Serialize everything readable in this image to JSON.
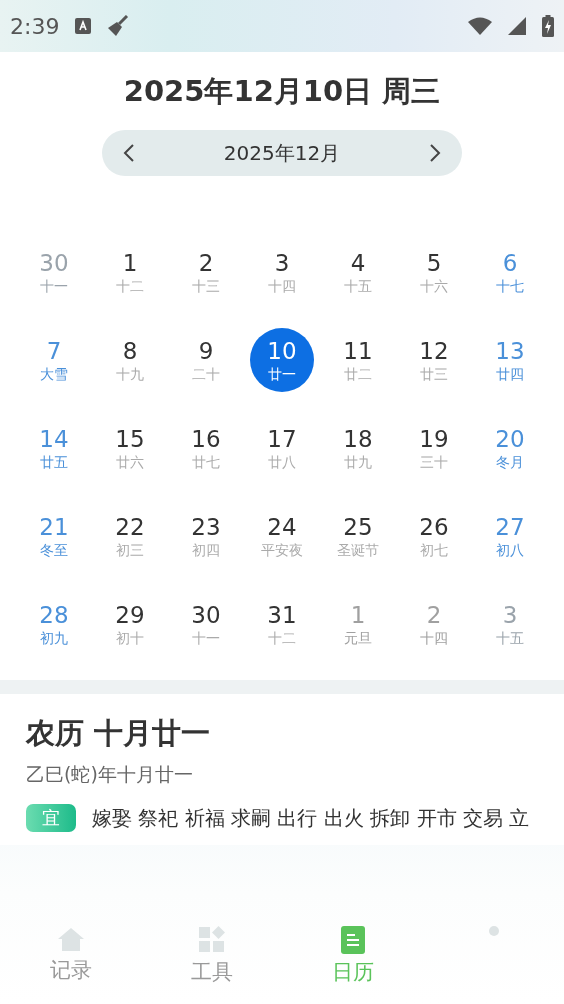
{
  "status_bar": {
    "time": "2:39"
  },
  "header": {
    "title": "2025年12月10日 周三",
    "month": "2025年12月"
  },
  "days": [
    {
      "day": "30",
      "lunar": "十一",
      "muted": true,
      "weekend": true,
      "selected": false
    },
    {
      "day": "1",
      "lunar": "十二",
      "muted": false,
      "weekend": false,
      "selected": false
    },
    {
      "day": "2",
      "lunar": "十三",
      "muted": false,
      "weekend": false,
      "selected": false
    },
    {
      "day": "3",
      "lunar": "十四",
      "muted": false,
      "weekend": false,
      "selected": false
    },
    {
      "day": "4",
      "lunar": "十五",
      "muted": false,
      "weekend": false,
      "selected": false
    },
    {
      "day": "5",
      "lunar": "十六",
      "muted": false,
      "weekend": false,
      "selected": false
    },
    {
      "day": "6",
      "lunar": "十七",
      "muted": false,
      "weekend": true,
      "selected": false
    },
    {
      "day": "7",
      "lunar": "大雪",
      "muted": false,
      "weekend": true,
      "selected": false
    },
    {
      "day": "8",
      "lunar": "十九",
      "muted": false,
      "weekend": false,
      "selected": false
    },
    {
      "day": "9",
      "lunar": "二十",
      "muted": false,
      "weekend": false,
      "selected": false
    },
    {
      "day": "10",
      "lunar": "廿一",
      "muted": false,
      "weekend": false,
      "selected": true
    },
    {
      "day": "11",
      "lunar": "廿二",
      "muted": false,
      "weekend": false,
      "selected": false
    },
    {
      "day": "12",
      "lunar": "廿三",
      "muted": false,
      "weekend": false,
      "selected": false
    },
    {
      "day": "13",
      "lunar": "廿四",
      "muted": false,
      "weekend": true,
      "selected": false
    },
    {
      "day": "14",
      "lunar": "廿五",
      "muted": false,
      "weekend": true,
      "selected": false
    },
    {
      "day": "15",
      "lunar": "廿六",
      "muted": false,
      "weekend": false,
      "selected": false
    },
    {
      "day": "16",
      "lunar": "廿七",
      "muted": false,
      "weekend": false,
      "selected": false
    },
    {
      "day": "17",
      "lunar": "廿八",
      "muted": false,
      "weekend": false,
      "selected": false
    },
    {
      "day": "18",
      "lunar": "廿九",
      "muted": false,
      "weekend": false,
      "selected": false
    },
    {
      "day": "19",
      "lunar": "三十",
      "muted": false,
      "weekend": false,
      "selected": false
    },
    {
      "day": "20",
      "lunar": "冬月",
      "muted": false,
      "weekend": true,
      "selected": false
    },
    {
      "day": "21",
      "lunar": "冬至",
      "muted": false,
      "weekend": true,
      "selected": false
    },
    {
      "day": "22",
      "lunar": "初三",
      "muted": false,
      "weekend": false,
      "selected": false
    },
    {
      "day": "23",
      "lunar": "初四",
      "muted": false,
      "weekend": false,
      "selected": false
    },
    {
      "day": "24",
      "lunar": "平安夜",
      "muted": false,
      "weekend": false,
      "selected": false
    },
    {
      "day": "25",
      "lunar": "圣诞节",
      "muted": false,
      "weekend": false,
      "selected": false
    },
    {
      "day": "26",
      "lunar": "初七",
      "muted": false,
      "weekend": false,
      "selected": false
    },
    {
      "day": "27",
      "lunar": "初八",
      "muted": false,
      "weekend": true,
      "selected": false
    },
    {
      "day": "28",
      "lunar": "初九",
      "muted": false,
      "weekend": true,
      "selected": false
    },
    {
      "day": "29",
      "lunar": "初十",
      "muted": false,
      "weekend": false,
      "selected": false
    },
    {
      "day": "30",
      "lunar": "十一",
      "muted": false,
      "weekend": false,
      "selected": false
    },
    {
      "day": "31",
      "lunar": "十二",
      "muted": false,
      "weekend": false,
      "selected": false
    },
    {
      "day": "1",
      "lunar": "元旦",
      "muted": true,
      "weekend": false,
      "selected": false
    },
    {
      "day": "2",
      "lunar": "十四",
      "muted": true,
      "weekend": false,
      "selected": false
    },
    {
      "day": "3",
      "lunar": "十五",
      "muted": true,
      "weekend": true,
      "selected": false
    }
  ],
  "lunar": {
    "title": "农历 十月廿一",
    "subtitle": "乙巳(蛇)年十月廿一",
    "yi_tag": "宜",
    "yi_text": "嫁娶 祭祀 祈福 求嗣 出行 出火 拆卸 开市 交易 立"
  },
  "nav": [
    {
      "kind": "home",
      "label": "记录",
      "selected": false
    },
    {
      "kind": "tools",
      "label": "工具",
      "selected": false
    },
    {
      "kind": "calendar",
      "label": "日历",
      "selected": true
    },
    {
      "kind": "dot",
      "selected": false
    }
  ]
}
